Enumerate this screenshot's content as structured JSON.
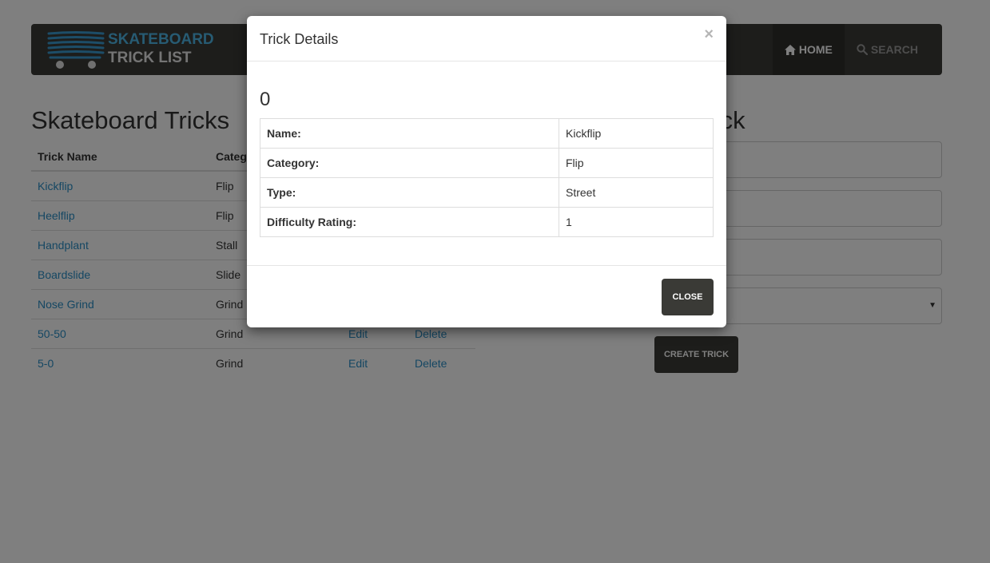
{
  "brand": {
    "line1": "SKATEBOARD",
    "line2": "TRICK LIST"
  },
  "nav": {
    "home": "HOME",
    "search": "SEARCH"
  },
  "list": {
    "title": "Skateboard Tricks",
    "columns": [
      "Trick Name",
      "Catego"
    ],
    "rows": [
      {
        "name": "Kickflip",
        "category": "Flip"
      },
      {
        "name": "Heelflip",
        "category": "Flip"
      },
      {
        "name": "Handplant",
        "category": "Stall"
      },
      {
        "name": "Boardslide",
        "category": "Slide"
      },
      {
        "name": "Nose Grind",
        "category": "Grind"
      },
      {
        "name": "50-50",
        "category": "Grind",
        "edit": "Edit",
        "delete": "Delete"
      },
      {
        "name": "5-0",
        "category": "Grind",
        "edit": "Edit",
        "delete": "Delete"
      }
    ]
  },
  "form": {
    "title": "ew Trick",
    "submit": "CREATE TRICK"
  },
  "modal": {
    "title": "Trick Details",
    "close_x": "×",
    "id": "0",
    "details": [
      {
        "label": "Name:",
        "value": "Kickflip"
      },
      {
        "label": "Category:",
        "value": "Flip"
      },
      {
        "label": "Type:",
        "value": "Street"
      },
      {
        "label": "Difficulty Rating:",
        "value": "1"
      }
    ],
    "close_button": "CLOSE"
  },
  "colors": {
    "navbar": "#3a3a36",
    "link": "#2a8fc7",
    "brand_blue": "#4fb6e6",
    "backdrop": "rgba(0,0,0,0.5)"
  }
}
